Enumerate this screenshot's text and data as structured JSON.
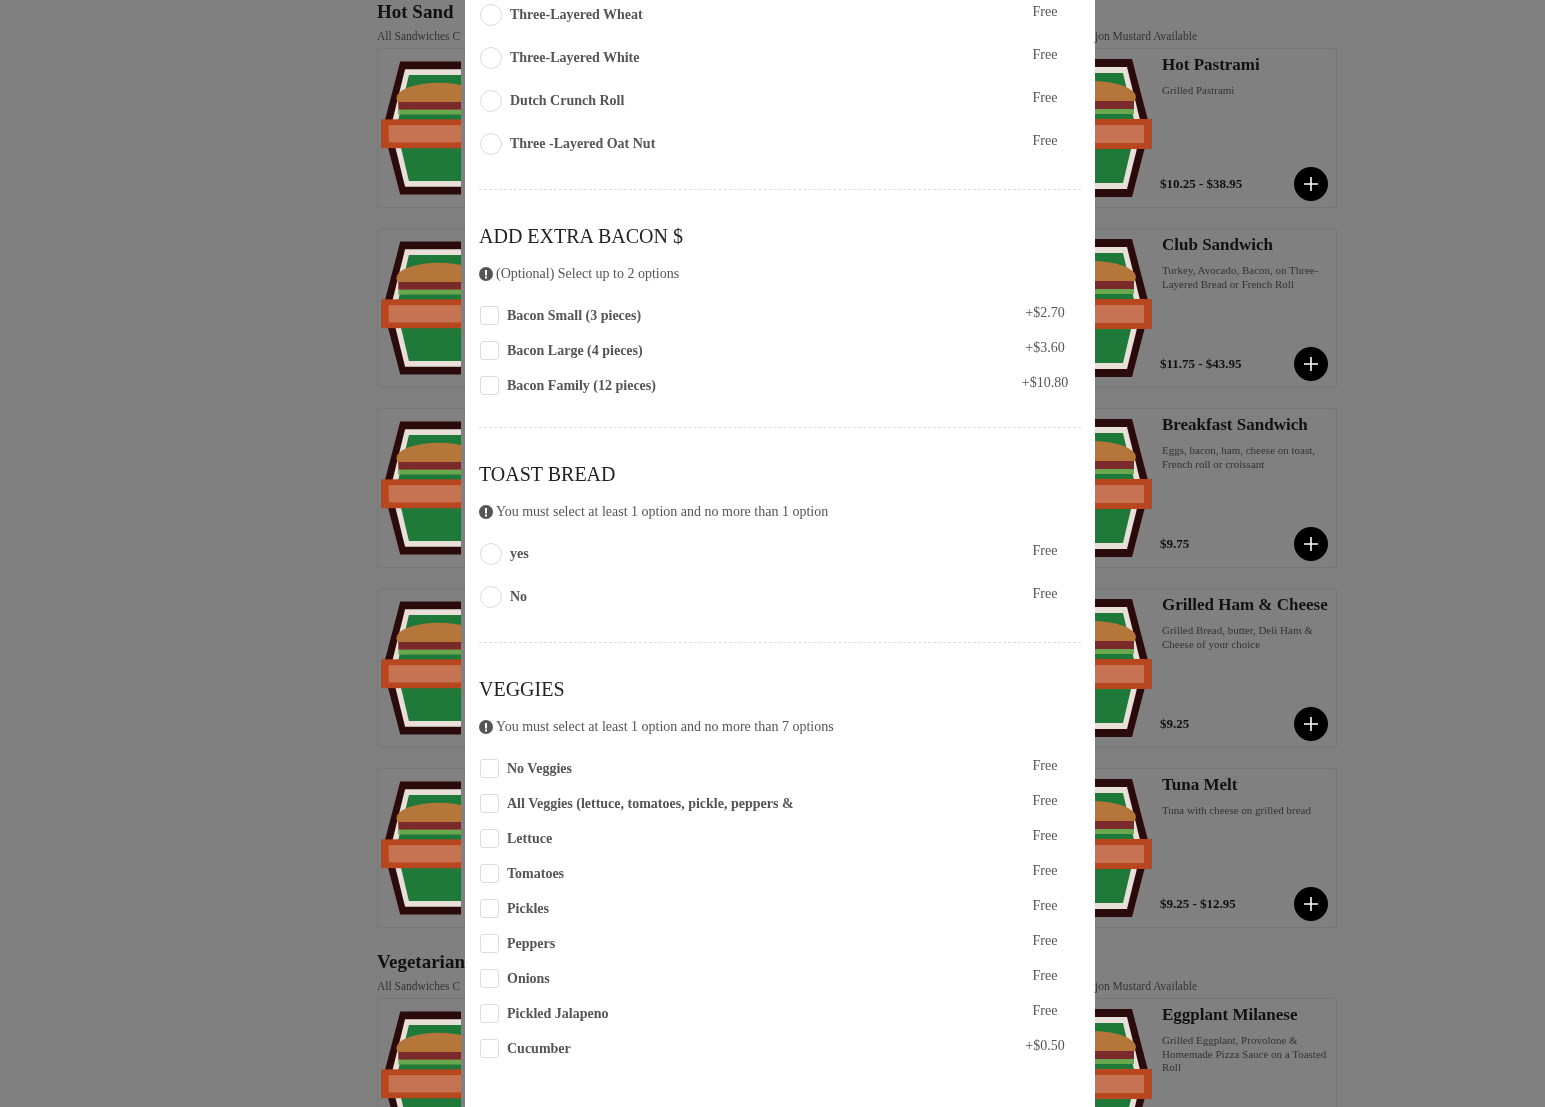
{
  "menu_background": {
    "sections": [
      {
        "title": "Hot Sand",
        "subtitle_left": "All Sandwiches C",
        "subtitle_right": "jon Mustard Available",
        "items": [
          {
            "name": "Hot Pastrami",
            "description": "Grilled Pastrami",
            "price": "$10.25 - $38.95"
          },
          {
            "name": "Club Sandwich",
            "description": "Turkey, Avocado, Bacon, on Three-Layered Bread or French Roll",
            "price": "$11.75 - $43.95"
          },
          {
            "name": "Breakfast Sandwich",
            "description": "Eggs, bacon, ham, cheese on toast, French roll or croissant",
            "price": "$9.75"
          },
          {
            "name": "Grilled Ham & Cheese",
            "description": "Grilled Bread, butter, Deli Ham & Cheese of your choice",
            "price": "$9.25"
          },
          {
            "name": "Tuna Melt",
            "description": "Tuna with cheese on grilled bread",
            "price": "$9.25 - $12.95"
          }
        ]
      },
      {
        "title": "Vegetarian",
        "subtitle_left": "All Sandwiches C",
        "subtitle_right": "jon Mustard Available",
        "items": [
          {
            "name": "Eggplant Milanese",
            "description": "Grilled Eggplant, Provolone & Homemade Pizza Sauce on a Toasted Roll"
          }
        ]
      }
    ]
  },
  "modal": {
    "option_groups": [
      {
        "kind": "radio",
        "options": [
          {
            "label": "Three-Layered Wheat",
            "price": "Free",
            "selected": false
          },
          {
            "label": "Three-Layered White",
            "price": "Free",
            "selected": false
          },
          {
            "label": "Dutch Crunch Roll",
            "price": "Free",
            "selected": false
          },
          {
            "label": "Three -Layered Oat Nut",
            "price": "Free",
            "selected": false
          }
        ]
      },
      {
        "kind": "checkbox",
        "title": "ADD EXTRA BACON $",
        "note": "(Optional) Select up to 2 options",
        "options": [
          {
            "label": "Bacon Small (3 pieces)",
            "price": "+$2.70",
            "checked": false
          },
          {
            "label": "Bacon Large (4 pieces)",
            "price": "+$3.60",
            "checked": false
          },
          {
            "label": "Bacon Family (12 pieces)",
            "price": "+$10.80",
            "checked": false
          }
        ]
      },
      {
        "kind": "radio",
        "title": "TOAST BREAD",
        "note": "You must select at least 1 option and no more than 1 option",
        "options": [
          {
            "label": "yes",
            "price": "Free",
            "selected": false
          },
          {
            "label": "No",
            "price": "Free",
            "selected": false
          }
        ]
      },
      {
        "kind": "checkbox",
        "title": "VEGGIES",
        "note": "You must select at least 1 option and no more than 7 options",
        "options": [
          {
            "label": "No Veggies",
            "price": "Free",
            "checked": false
          },
          {
            "label": "All Veggies (lettuce, tomatoes, pickle, peppers &",
            "price": "Free",
            "checked": false
          },
          {
            "label": "Lettuce",
            "price": "Free",
            "checked": false
          },
          {
            "label": "Tomatoes",
            "price": "Free",
            "checked": false
          },
          {
            "label": "Pickles",
            "price": "Free",
            "checked": false
          },
          {
            "label": "Peppers",
            "price": "Free",
            "checked": false
          },
          {
            "label": "Onions",
            "price": "Free",
            "checked": false
          },
          {
            "label": "Pickled Jalapeno",
            "price": "Free",
            "checked": false
          },
          {
            "label": "Cucumber",
            "price": "+$0.50",
            "checked": false
          }
        ]
      }
    ]
  }
}
